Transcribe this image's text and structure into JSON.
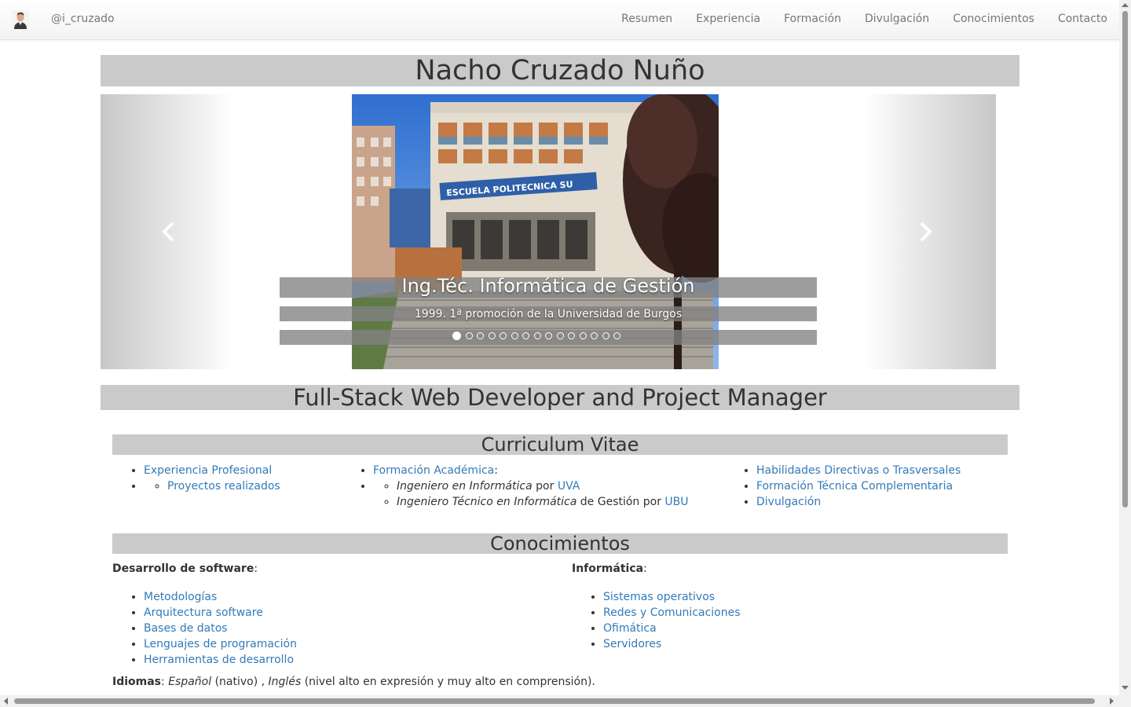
{
  "navbar": {
    "brand": "@i_cruzado",
    "items": [
      "Resumen",
      "Experiencia",
      "Formación",
      "Divulgación",
      "Conocimientos",
      "Contacto"
    ]
  },
  "title": "Nacho Cruzado Nuño",
  "carousel": {
    "caption_title": "Ing.Téc. Informática de Gestión",
    "caption_text": "1999. 1ª promoción de la Universidad de Burgos",
    "slide_count": 15,
    "active_slide": 1,
    "image_signage": "ESCUELA POLITECNICA SU"
  },
  "subtitle": "Full-Stack Web Developer and Project Manager",
  "cv": {
    "heading": "Curriculum Vitae",
    "experience": "Experiencia Profesional",
    "projects": "Proyectos realizados",
    "academic": "Formación Académica",
    "colon": ":",
    "degree1": "Ingeniero en Informática",
    "degree2": "Ingeniero Técnico en Informática",
    "by": "por",
    "de_gestion": "de Gestión por",
    "uva": "UVA",
    "ubu": "UBU",
    "skills": "Habilidades Directivas o Trasversales",
    "technical": "Formación Técnica Complementaria",
    "outreach": "Divulgación"
  },
  "knowledge": {
    "heading": "Conocimientos",
    "software_heading": "Desarrollo de software",
    "software_items": [
      "Metodologías",
      "Arquitectura software",
      "Bases de datos",
      "Lenguajes de programación",
      "Herramientas de desarrollo"
    ],
    "it_heading": "Informática",
    "it_items": [
      "Sistemas operativos",
      "Redes y Comunicaciones",
      "Ofimática",
      "Servidores"
    ],
    "colon": ":"
  },
  "languages": {
    "label": "Idiomas",
    "colon": ":",
    "spanish": "Español",
    "spanish_level": "(nativo) ,",
    "english": "Inglés",
    "english_level": "(nivel alto en expresión y muy alto en comprensión)."
  }
}
